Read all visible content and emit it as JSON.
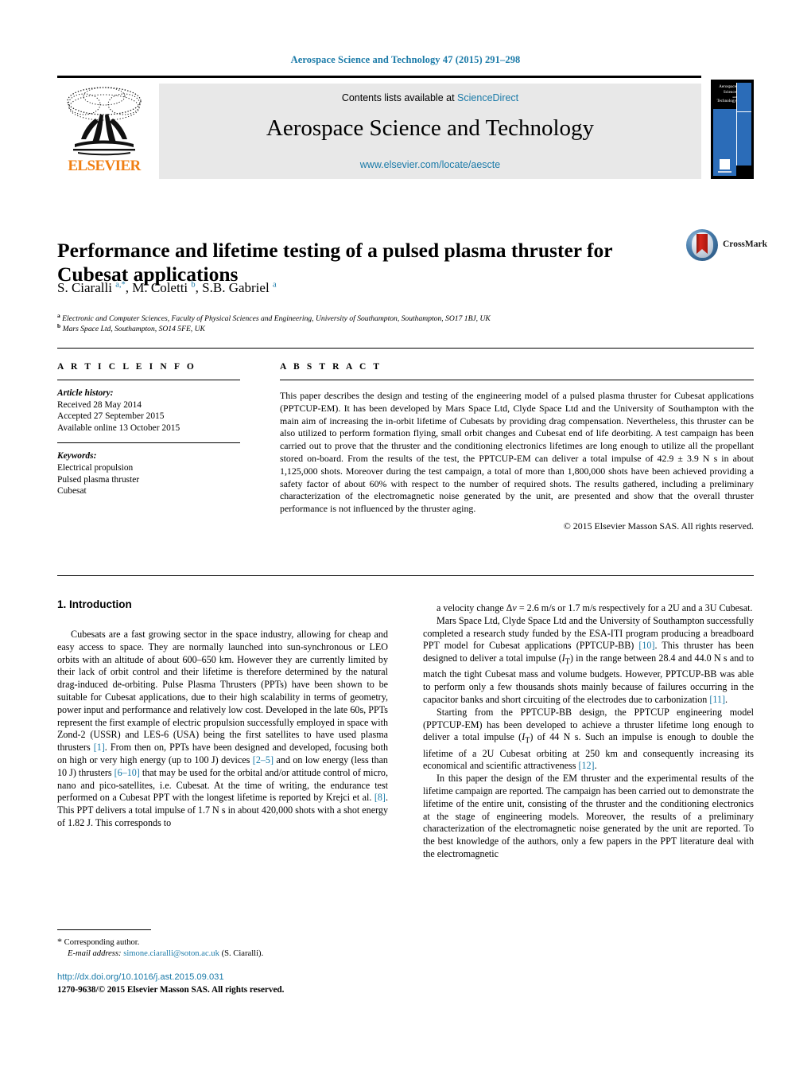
{
  "running_head": "Aerospace Science and Technology 47 (2015) 291–298",
  "masthead": {
    "publisher_name": "ELSEVIER",
    "contents_prefix": "Contents lists available at",
    "contents_link": "ScienceDirect",
    "journal_title": "Aerospace Science and Technology",
    "journal_url": "www.elsevier.com/locate/aescte",
    "cover_title_line1": "Aerospace",
    "cover_title_line2": "Science",
    "cover_title_small": "and",
    "cover_title_line3": "Technology"
  },
  "article": {
    "title": "Performance and lifetime testing of a pulsed plasma thruster for Cubesat applications",
    "authors_html": "S. Ciaralli <sup>a,*</sup>, M. Coletti <sup>b</sup>, S.B. Gabriel <sup>a</sup>",
    "affiliation_a": "Electronic and Computer Sciences, Faculty of Physical Sciences and Engineering, University of Southampton, Southampton, SO17 1BJ, UK",
    "affiliation_b": "Mars Space Ltd, Southampton, SO14 5FE, UK",
    "crossmark_label": "CrossMark"
  },
  "info": {
    "heading": "A R T I C L E    I N F O",
    "history_label": "Article history:",
    "history": [
      "Received 28 May 2014",
      "Accepted 27 September 2015",
      "Available online 13 October 2015"
    ],
    "keywords_label": "Keywords:",
    "keywords": [
      "Electrical propulsion",
      "Pulsed plasma thruster",
      "Cubesat"
    ]
  },
  "abstract": {
    "heading": "A B S T R A C T",
    "text": "This paper describes the design and testing of the engineering model of a pulsed plasma thruster for Cubesat applications (PPTCUP-EM). It has been developed by Mars Space Ltd, Clyde Space Ltd and the University of Southampton with the main aim of increasing the in-orbit lifetime of Cubesats by providing drag compensation. Nevertheless, this thruster can be also utilized to perform formation flying, small orbit changes and Cubesat end of life deorbiting. A test campaign has been carried out to prove that the thruster and the conditioning electronics lifetimes are long enough to utilize all the propellant stored on-board. From the results of the test, the PPTCUP-EM can deliver a total impulse of 42.9 ± 3.9 N s in about 1,125,000 shots. Moreover during the test campaign, a total of more than 1,800,000 shots have been achieved providing a safety factor of about 60% with respect to the number of required shots. The results gathered, including a preliminary characterization of the electromagnetic noise generated by the unit, are presented and show that the overall thruster performance is not influenced by the thruster aging.",
    "copyright": "© 2015 Elsevier Masson SAS. All rights reserved."
  },
  "body": {
    "section_heading": "1. Introduction",
    "left_paragraph_1_html": "Cubesats are a fast growing sector in the space industry, allowing for cheap and easy access to space. They are normally launched into sun-synchronous or LEO orbits with an altitude of about 600–650 km. However they are currently limited by their lack of orbit control and their lifetime is therefore determined by the natural drag-induced de-orbiting. Pulse Plasma Thrusters (PPTs) have been shown to be suitable for Cubesat applications, due to their high scalability in terms of geometry, power input and performance and relatively low cost. Developed in the late 60s, PPTs represent the first example of electric propulsion successfully employed in space with Zond-2 (USSR) and LES-6 (USA) being the first satellites to have used plasma thrusters <span class=\"cit\">[1]</span>. From then on, PPTs have been designed and developed, focusing both on high or very high energy (up to 100 J) devices <span class=\"cit\">[2–5]</span> and on low energy (less than 10 J) thrusters <span class=\"cit\">[6–10]</span> that may be used for the orbital and/or attitude control of micro, nano and pico-satellites, i.e. Cubesat. At the time of writing, the endurance test performed on a Cubesat PPT with the longest lifetime is reported by Krejci et al. <span class=\"cit\">[8]</span>. This PPT delivers a total impulse of 1.7 N s in about 420,000 shots with a shot energy of 1.82 J. This corresponds to",
    "right_paragraph_1_html": "a velocity change Δ<i>v</i> = 2.6 m/s or 1.7 m/s respectively for a 2U and a 3U Cubesat.",
    "right_paragraph_2_html": "Mars Space Ltd, Clyde Space Ltd and the University of Southampton successfully completed a research study funded by the ESA-ITI program producing a breadboard PPT model for Cubesat applications (PPTCUP-BB) <span class=\"cit\">[10]</span>. This thruster has been designed to deliver a total impulse (<i>I</i><sub>T</sub>) in the range between 28.4 and 44.0 N s and to match the tight Cubesat mass and volume budgets. However, PPTCUP-BB was able to perform only a few thousands shots mainly because of failures occurring in the capacitor banks and short circuiting of the electrodes due to carbonization <span class=\"cit\">[11]</span>.",
    "right_paragraph_3_html": "Starting from the PPTCUP-BB design, the PPTCUP engineering model (PPTCUP-EM) has been developed to achieve a thruster lifetime long enough to deliver a total impulse (<i>I</i><sub>T</sub>) of 44 N s. Such an impulse is enough to double the lifetime of a 2U Cubesat orbiting at 250 km and consequently increasing its economical and scientific attractiveness <span class=\"cit\">[12]</span>.",
    "right_paragraph_4_html": "In this paper the design of the EM thruster and the experimental results of the lifetime campaign are reported. The campaign has been carried out to demonstrate the lifetime of the entire unit, consisting of the thruster and the conditioning electronics at the stage of engineering models. Moreover, the results of a preliminary characterization of the electromagnetic noise generated by the unit are reported. To the best knowledge of the authors, only a few papers in the PPT literature deal with the electromagnetic"
  },
  "footer": {
    "corresponding_author": "Corresponding author.",
    "email_label": "E-mail address:",
    "email": "simone.ciaralli@soton.ac.uk",
    "email_suffix": "(S. Ciaralli).",
    "doi": "http://dx.doi.org/10.1016/j.ast.2015.09.031",
    "issn": "1270-9638/© 2015 Elsevier Masson SAS. All rights reserved."
  },
  "colors": {
    "link": "#1a7aa8",
    "elsevier_orange": "#f07f13",
    "cover_blue": "#2b6cb8",
    "masthead_gray": "#e8e8e8"
  }
}
